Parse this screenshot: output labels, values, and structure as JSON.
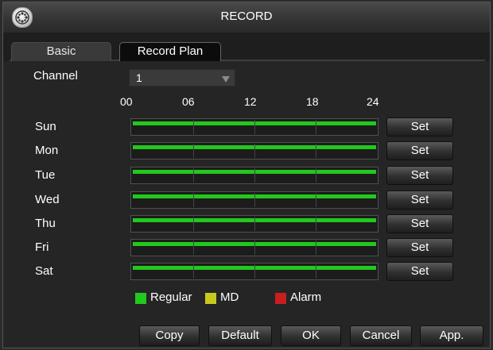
{
  "window": {
    "title": "RECORD"
  },
  "tabs": [
    {
      "label": "Basic",
      "active": false
    },
    {
      "label": "Record Plan",
      "active": true
    }
  ],
  "channel": {
    "label": "Channel",
    "value": "1"
  },
  "timeline": {
    "hours": [
      "00",
      "06",
      "12",
      "18",
      "24"
    ]
  },
  "days": [
    {
      "label": "Sun",
      "button": "Set",
      "schedule": "Regular 00-24"
    },
    {
      "label": "Mon",
      "button": "Set",
      "schedule": "Regular 00-24"
    },
    {
      "label": "Tue",
      "button": "Set",
      "schedule": "Regular 00-24"
    },
    {
      "label": "Wed",
      "button": "Set",
      "schedule": "Regular 00-24"
    },
    {
      "label": "Thu",
      "button": "Set",
      "schedule": "Regular 00-24"
    },
    {
      "label": "Fri",
      "button": "Set",
      "schedule": "Regular 00-24"
    },
    {
      "label": "Sat",
      "button": "Set",
      "schedule": "Regular 00-24"
    }
  ],
  "legend": [
    {
      "label": "Regular",
      "color": "#22c81e"
    },
    {
      "label": "MD",
      "color": "#c8c81e"
    },
    {
      "label": "Alarm",
      "color": "#c81e1e"
    }
  ],
  "buttons": {
    "copy": "Copy",
    "default": "Default",
    "ok": "OK",
    "cancel": "Cancel",
    "apply": "App."
  }
}
